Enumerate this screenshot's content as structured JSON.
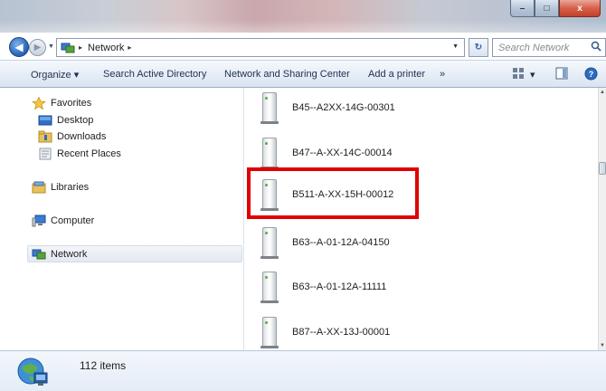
{
  "window": {
    "controls": {
      "minimize": "–",
      "maximize": "□",
      "close": "x"
    }
  },
  "address": {
    "crumb_sep": "▸",
    "location": "Network",
    "dropdown": "▼",
    "refresh": "↻",
    "search_placeholder": "Search Network"
  },
  "nav_buttons": {
    "back": "◀",
    "forward": "▶",
    "history": "▼"
  },
  "toolbar": {
    "organize": "Organize ▾",
    "search_ad": "Search Active Directory",
    "network_sharing": "Network and Sharing Center",
    "add_printer": "Add a printer",
    "more": "»",
    "views_dd": "▾"
  },
  "navpane": {
    "favorites": "Favorites",
    "desktop": "Desktop",
    "downloads": "Downloads",
    "recent_places": "Recent Places",
    "libraries": "Libraries",
    "computer": "Computer",
    "network": "Network"
  },
  "items": [
    {
      "name": "B45--A2XX-14G-00301"
    },
    {
      "name": "B47--A-XX-14C-00014"
    },
    {
      "name": "B511-A-XX-15H-00012",
      "highlighted": true
    },
    {
      "name": "B63--A-01-12A-04150"
    },
    {
      "name": "B63--A-01-12A-11111"
    },
    {
      "name": "B87--A-XX-13J-00001"
    }
  ],
  "scrollbar": {
    "up": "▲",
    "down": "▼"
  },
  "details": {
    "count": "112 items"
  },
  "colors": {
    "highlight": "#e00000",
    "accent": "#2d6cc0"
  }
}
